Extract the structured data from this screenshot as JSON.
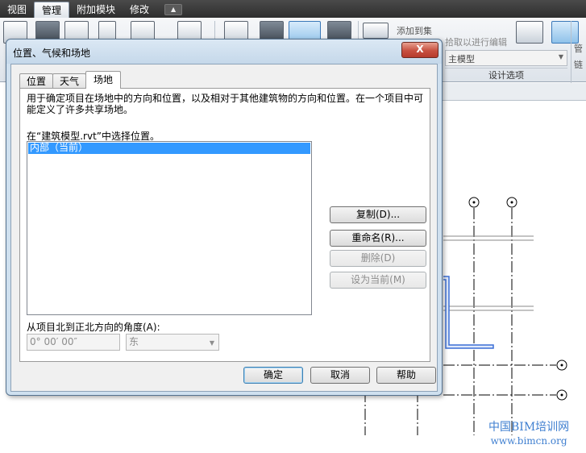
{
  "menubar": {
    "tabs": [
      "视图",
      "管理",
      "附加模块",
      "修改"
    ],
    "active_tab": "管理"
  },
  "ribbon": {
    "labels": {
      "add_to_set": "添加到集",
      "edit_link": "拾取以进行编辑",
      "model_combo": "主模型",
      "design_options_group": "设计选项",
      "side_label_1": "管",
      "side_label_2": "链"
    },
    "icons": [
      "project-units-icon",
      "project-info-icon",
      "numbering-icon",
      "object-styles-icon",
      "transfer-standards-icon",
      "location-icon",
      "coordinates-icon",
      "position-icon",
      "design-options-icon",
      "manage-links-icon",
      "rendering-icon"
    ]
  },
  "dialog": {
    "title": "位置、气候和场地",
    "close_glyph": "X",
    "tabs": [
      {
        "label": "位置"
      },
      {
        "label": "天气"
      },
      {
        "label": "场地"
      }
    ],
    "active_tab": "场地",
    "description": "用于确定项目在场地中的方向和位置，以及相对于其他建筑物的方向和位置。在一个项目中可能定义了许多共享场地。",
    "list_label": "在“建筑模型.rvt”中选择位置。",
    "sites": [
      {
        "label": "内部（当前）",
        "selected": true
      }
    ],
    "side_buttons": {
      "duplicate": "复制(D)...",
      "rename": "重命名(R)...",
      "delete": "删除(D)",
      "make_current": "设为当前(M)"
    },
    "angle_label": "从项目北到正北方向的角度(A):",
    "angle_value": "0°  00′  00″",
    "direction_value": "东",
    "buttons": {
      "ok": "确定",
      "cancel": "取消",
      "help": "帮助"
    }
  },
  "watermark": {
    "line1": "中国BIM培训网",
    "line2": "www.bimcn.org"
  },
  "colors": {
    "selection": "#3399ff",
    "dialog_frame": "#cfe0ef",
    "close_button": "#c75040",
    "drawing_highlight": "#3b6fd6",
    "watermark": "#3f7fd0"
  }
}
